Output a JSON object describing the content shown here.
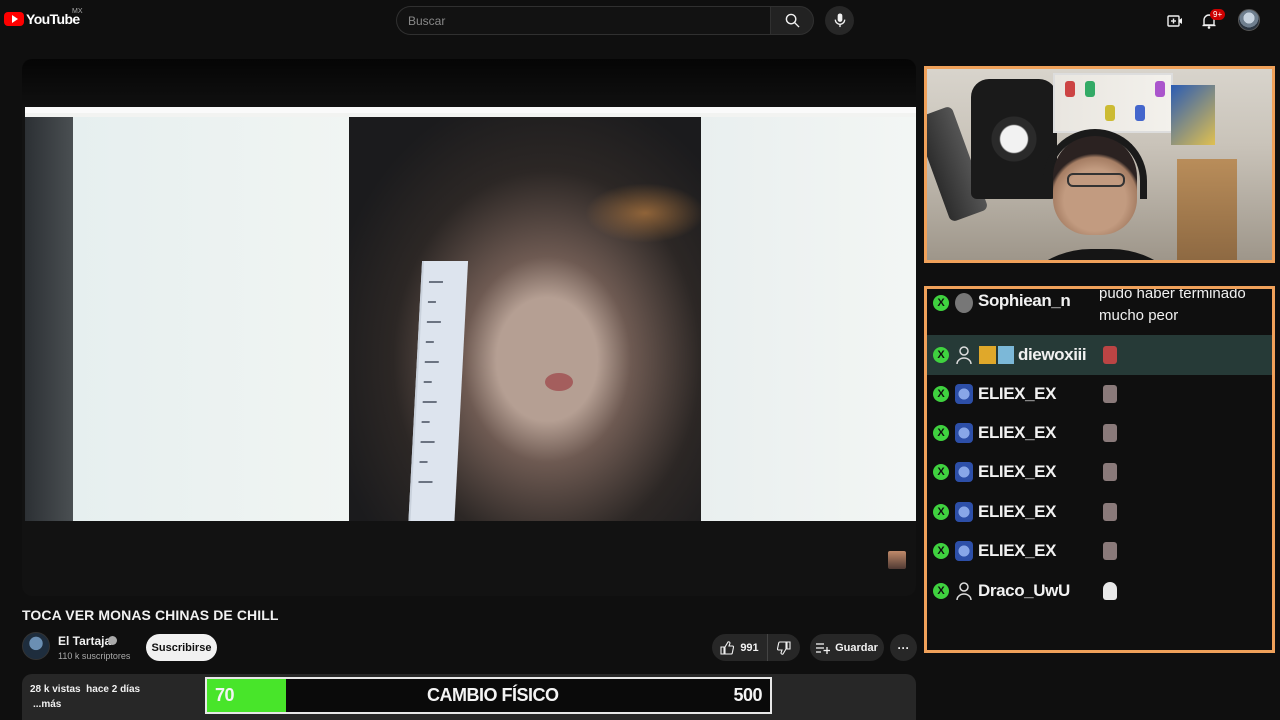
{
  "header": {
    "logo_text": "YouTube",
    "region": "MX",
    "search_placeholder": "Buscar",
    "notifications_badge": "9+",
    "icons": [
      "search-icon",
      "mic-icon",
      "create-icon",
      "bell-icon",
      "avatar"
    ]
  },
  "video": {
    "title": "TOCA VER MONAS CHINAS DE CHILL",
    "channel_name": "El Tartaja",
    "subscribers": "110 k suscriptores",
    "subscribe_label": "Suscribirse",
    "likes": "991",
    "save_label": "Guardar",
    "more_label": "···",
    "views_date": "28 k vistas  hace 2 días",
    "more_desc": "...más"
  },
  "overlay_goal": {
    "current": "70",
    "label": "CAMBIO FÍSICO",
    "target": "500",
    "progress": 0.14,
    "fill_color": "#48e52a"
  },
  "chat": {
    "border_color": "#f0a15a",
    "messages": [
      {
        "user": "Sophiean_n",
        "text_line1": "pudo haber terminado",
        "text_line2": "mucho peor",
        "highlight": false
      },
      {
        "user": "diewoxiii",
        "text_line1": "",
        "text_line2": "",
        "highlight": true
      },
      {
        "user": "ELIEX_EX",
        "text_line1": "",
        "text_line2": "",
        "highlight": false
      },
      {
        "user": "ELIEX_EX",
        "text_line1": "",
        "text_line2": "",
        "highlight": false
      },
      {
        "user": "ELIEX_EX",
        "text_line1": "",
        "text_line2": "",
        "highlight": false
      },
      {
        "user": "ELIEX_EX",
        "text_line1": "",
        "text_line2": "",
        "highlight": false
      },
      {
        "user": "ELIEX_EX",
        "text_line1": "",
        "text_line2": "",
        "highlight": false
      },
      {
        "user": "Draco_UwU",
        "text_line1": "",
        "text_line2": "",
        "highlight": false
      }
    ]
  }
}
